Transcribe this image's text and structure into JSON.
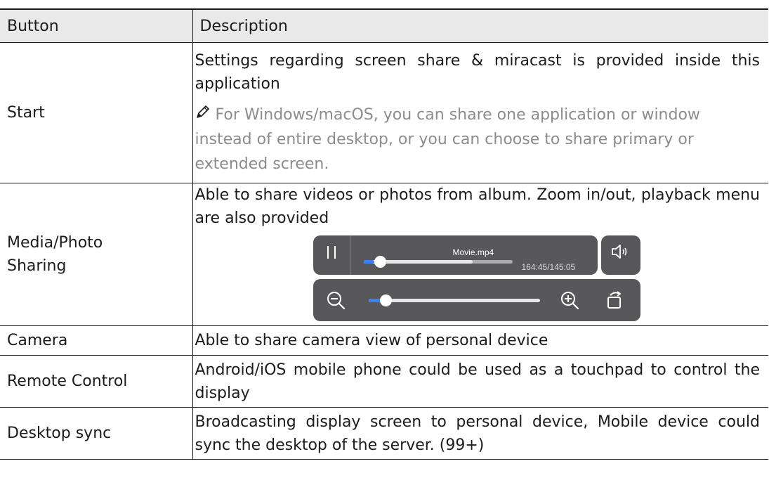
{
  "table": {
    "headers": {
      "button": "Button",
      "description": "Description"
    },
    "rows": [
      {
        "button": "Start",
        "description": "Settings regarding screen share & miracast is provided inside this application",
        "note": "For Windows/macOS, you can share one application or window instead of entire desktop, or you can choose to share primary or extended screen."
      },
      {
        "button": "Media/Photo Sharing",
        "description": "Able to share videos or photos from album. Zoom in/out, playback menu are also provided",
        "media": {
          "file_name": "Movie.mp4",
          "time_display": "164:45/145:05",
          "playback_progress": 0.07,
          "buffered_progress": 0.73,
          "zoom_level": 0.1
        }
      },
      {
        "button": "Camera",
        "description": "Able to share camera view of personal device"
      },
      {
        "button": "Remote Control",
        "description": "Android/iOS mobile phone could be used as a touchpad to control the display"
      },
      {
        "button": "Desktop sync",
        "description": "Broadcasting display screen to personal device, Mobile device could sync the desktop of the server. (99+)"
      }
    ]
  },
  "icons": {
    "note": "pencil-icon",
    "pause": "pause-icon",
    "volume": "volume-icon",
    "zoom_out": "zoom-out-icon",
    "zoom_in": "zoom-in-icon",
    "rotate": "rotate-icon"
  },
  "colors": {
    "header_bg": "#e9e9e9",
    "note_text": "#8c8c8c",
    "control_bg": "#58585a",
    "progress_accent": "#3b82f6"
  }
}
